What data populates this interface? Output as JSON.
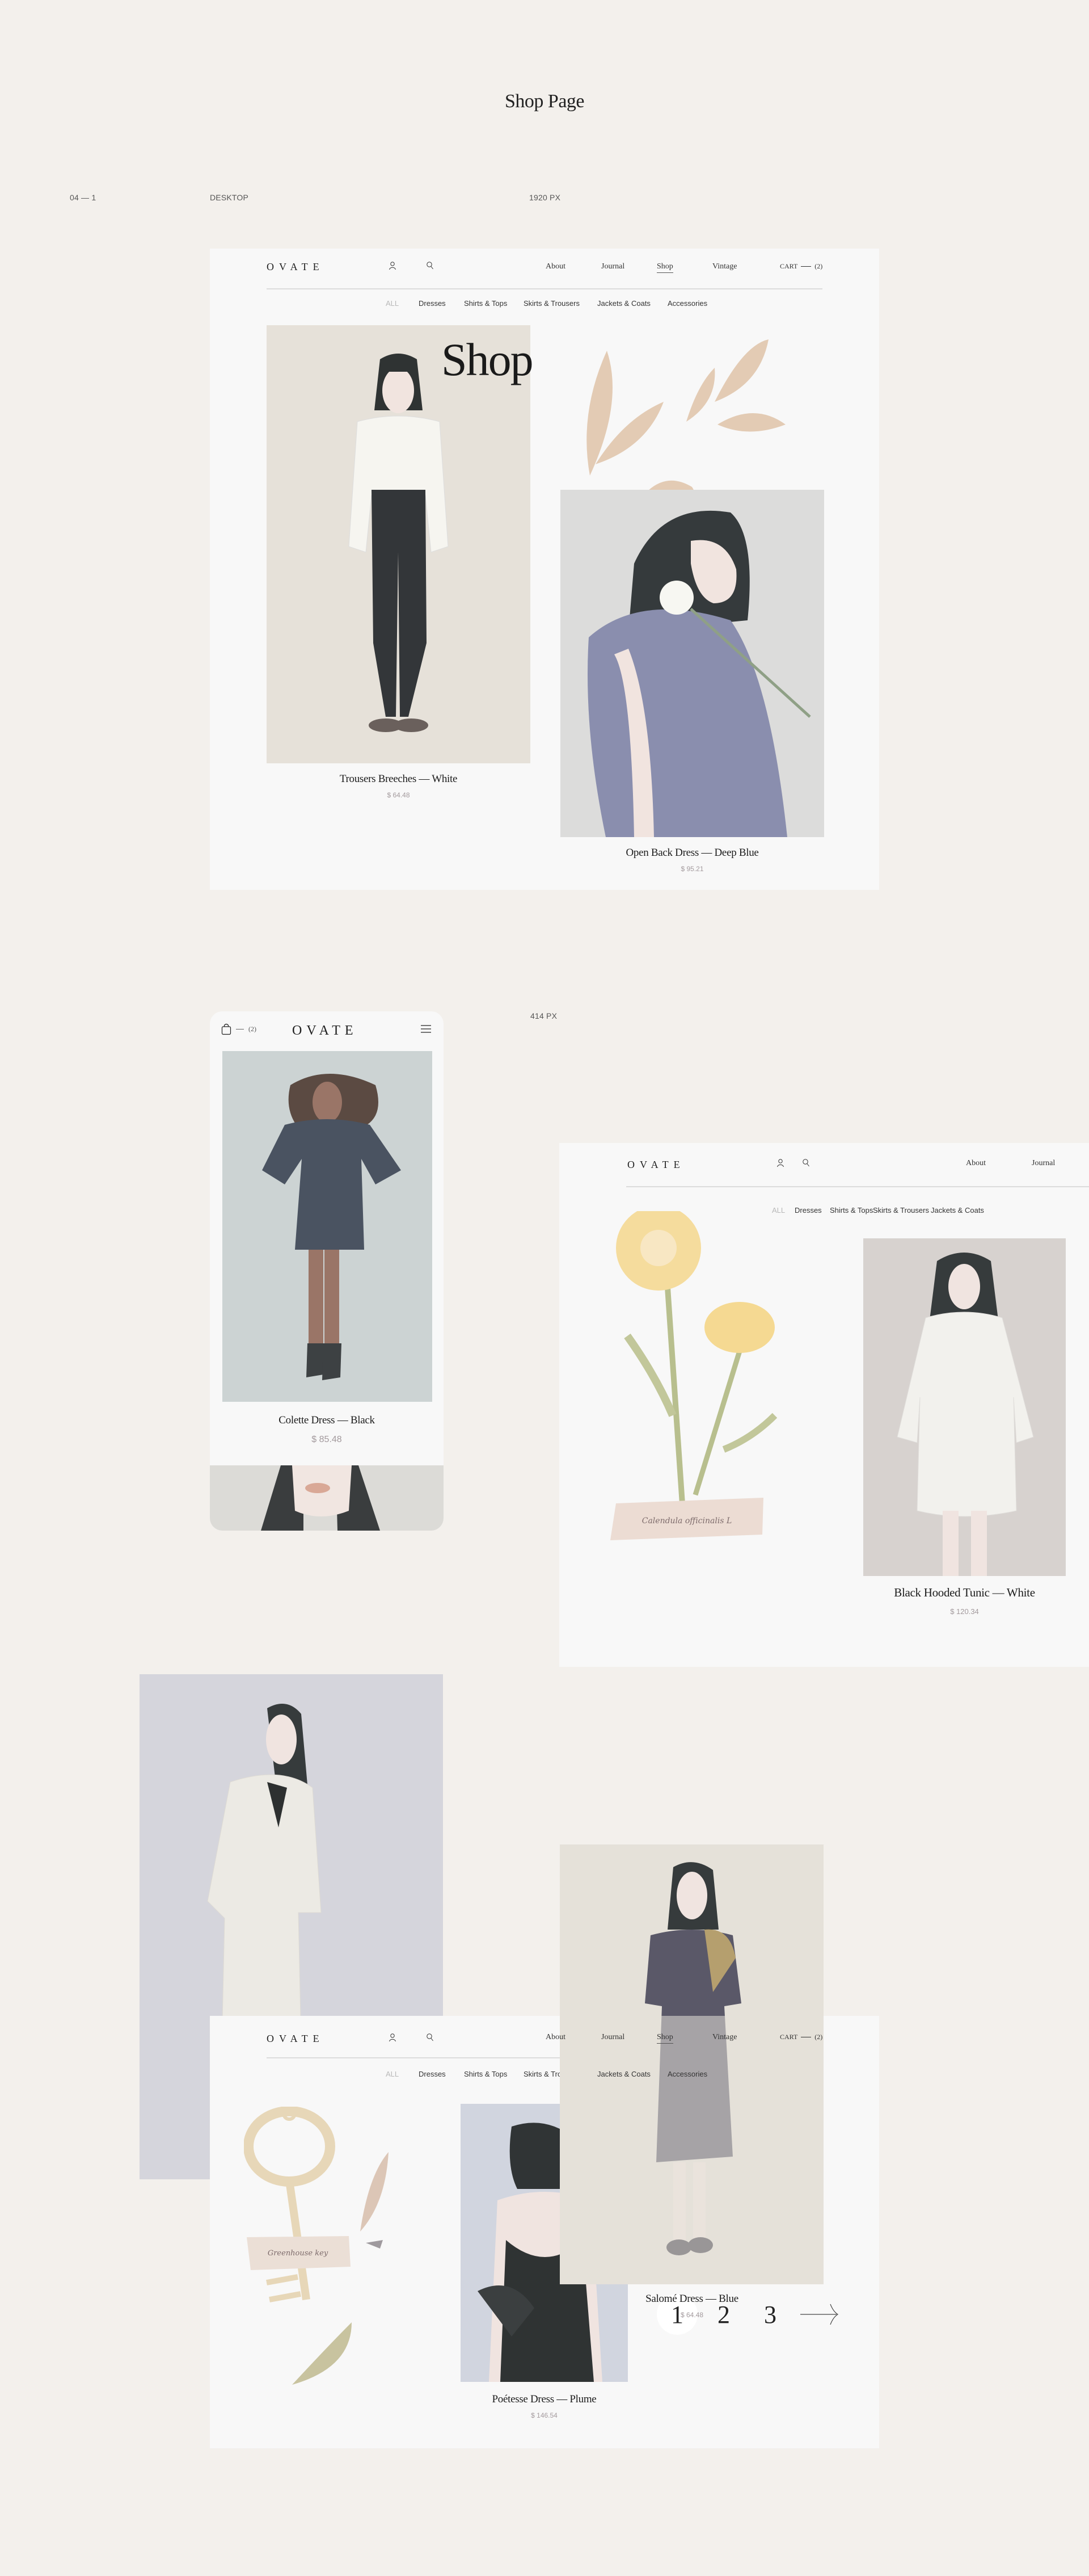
{
  "page": {
    "title": "Shop Page",
    "section_index": "04 — 1",
    "desktop_label": "DESKTOP",
    "desktop_width_label": "1920 PX",
    "mobile_width_label": "414 PX"
  },
  "brand": {
    "logo": "OVATE"
  },
  "nav": {
    "links": [
      {
        "label": "About",
        "active": false
      },
      {
        "label": "Journal",
        "active": false
      },
      {
        "label": "Shop",
        "active": true
      },
      {
        "label": "Vintage",
        "active": false
      }
    ],
    "cart_label": "CART",
    "cart_count": "(2)",
    "icons": {
      "account": "user-icon",
      "search": "search-icon",
      "bag": "shopping-bag-icon",
      "menu": "hamburger-menu-icon",
      "next": "arrow-right-icon"
    }
  },
  "categories": [
    {
      "label": "ALL",
      "active": true
    },
    {
      "label": "Dresses"
    },
    {
      "label": "Shirts & Tops"
    },
    {
      "label": "Skirts & Trousers"
    },
    {
      "label": "Jackets & Coats"
    },
    {
      "label": "Accessories"
    }
  ],
  "hero": {
    "heading": "Shop"
  },
  "products": [
    {
      "name": "Trousers Breeches — White",
      "price": "$ 64.48"
    },
    {
      "name": "Open Back Dress — Deep Blue",
      "price": "$ 95.21"
    },
    {
      "name": "Colette Dress — Black",
      "price": "$ 85.48"
    },
    {
      "name": "Black Hooded Tunic — White",
      "price": "$ 120.34"
    },
    {
      "name": "Salomé Dress — Blue",
      "price": "$ 64.48"
    },
    {
      "name": "Poétesse Dress — Plume",
      "price": "$ 146.54"
    }
  ],
  "illustration_labels": {
    "flower_tag": "Calendula officinalis L",
    "key_tag": "Greenhouse key"
  },
  "pagination": {
    "pages": [
      "1",
      "2",
      "3"
    ],
    "current": "1"
  },
  "colors": {
    "page_bg": "#f3f0ec",
    "card_bg": "#f8f8f8",
    "price": "#a39a9d",
    "muted_category": "#b8b8b8"
  }
}
